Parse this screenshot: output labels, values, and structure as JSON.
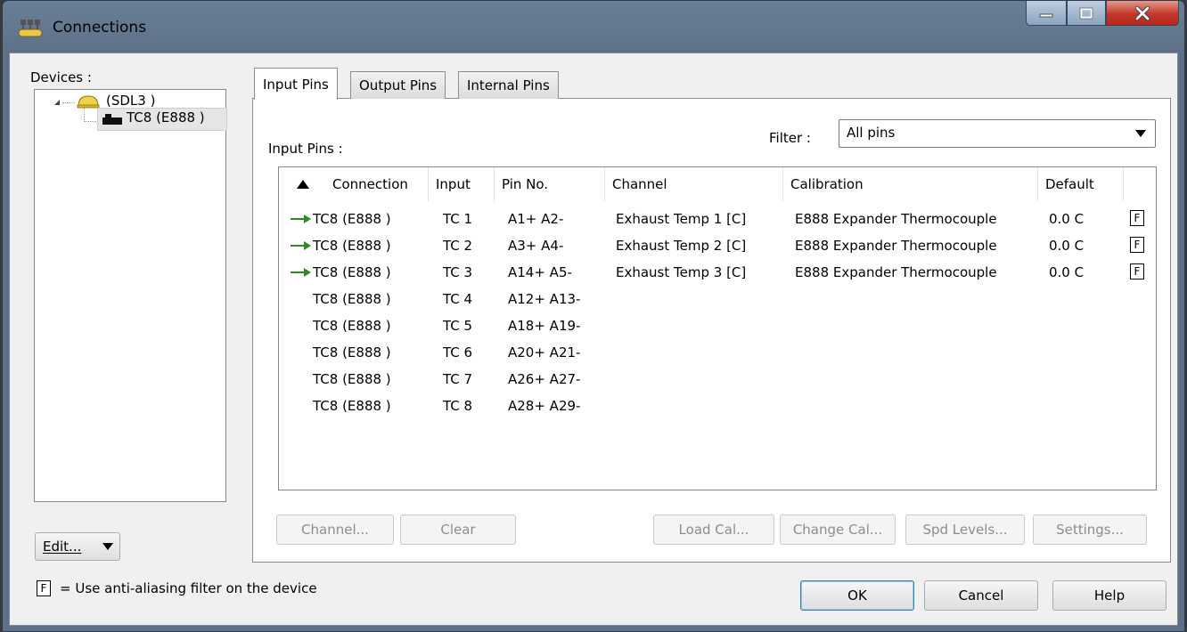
{
  "window": {
    "title": "Connections",
    "buttons": {
      "minimize": "minimize",
      "maximize": "maximize",
      "close": "close"
    }
  },
  "devices": {
    "label": "Devices :",
    "tree": [
      {
        "label": "(SDL3 )",
        "icon": "bus-icon",
        "expanded": true
      },
      {
        "label": "TC8 (E888 )",
        "icon": "device-icon",
        "selected": true
      }
    ],
    "edit_button": "Edit...",
    "edit_button_mnemonic": "E"
  },
  "tabs": [
    {
      "label": "Input Pins",
      "active": true
    },
    {
      "label": "Output Pins",
      "active": false
    },
    {
      "label": "Internal Pins",
      "active": false
    }
  ],
  "pins": {
    "label": "Input Pins :",
    "filter_label": "Filter :",
    "filter_value": "All pins",
    "columns": [
      "Connection",
      "Input",
      "Pin No.",
      "Channel",
      "Calibration",
      "Default"
    ],
    "sort_column": "Connection",
    "rows": [
      {
        "connected": true,
        "connection": "TC8 (E888 )",
        "input": "TC 1",
        "pin": "A1+ A2-",
        "channel": "Exhaust Temp 1 [C]",
        "calibration": "E888 Expander Thermocouple",
        "default": "0.0 C",
        "filter": "F"
      },
      {
        "connected": true,
        "connection": "TC8 (E888 )",
        "input": "TC 2",
        "pin": "A3+ A4-",
        "channel": "Exhaust Temp 2 [C]",
        "calibration": "E888 Expander Thermocouple",
        "default": "0.0 C",
        "filter": "F"
      },
      {
        "connected": true,
        "connection": "TC8 (E888 )",
        "input": "TC 3",
        "pin": "A14+ A5-",
        "channel": "Exhaust Temp 3 [C]",
        "calibration": "E888 Expander Thermocouple",
        "default": "0.0 C",
        "filter": "F"
      },
      {
        "connected": false,
        "connection": "TC8 (E888 )",
        "input": "TC 4",
        "pin": "A12+ A13-",
        "channel": "",
        "calibration": "",
        "default": "",
        "filter": ""
      },
      {
        "connected": false,
        "connection": "TC8 (E888 )",
        "input": "TC 5",
        "pin": "A18+ A19-",
        "channel": "",
        "calibration": "",
        "default": "",
        "filter": ""
      },
      {
        "connected": false,
        "connection": "TC8 (E888 )",
        "input": "TC 6",
        "pin": "A20+ A21-",
        "channel": "",
        "calibration": "",
        "default": "",
        "filter": ""
      },
      {
        "connected": false,
        "connection": "TC8 (E888 )",
        "input": "TC 7",
        "pin": "A26+ A27-",
        "channel": "",
        "calibration": "",
        "default": "",
        "filter": ""
      },
      {
        "connected": false,
        "connection": "TC8 (E888 )",
        "input": "TC 8",
        "pin": "A28+ A29-",
        "channel": "",
        "calibration": "",
        "default": "",
        "filter": ""
      }
    ]
  },
  "actions": {
    "channel": "Channel...",
    "clear": "Clear",
    "load_cal": "Load Cal...",
    "change_cal": "Change Cal...",
    "spd_levels": "Spd Levels...",
    "settings": "Settings..."
  },
  "legend": {
    "symbol": "F",
    "text": "= Use anti-aliasing filter on the device"
  },
  "dialog": {
    "ok": "OK",
    "cancel": "Cancel",
    "help": "Help"
  },
  "colors": {
    "connected_arrow": "#2e8b22",
    "titlebar": "#6a7f97",
    "close_button": "#c2372a"
  }
}
